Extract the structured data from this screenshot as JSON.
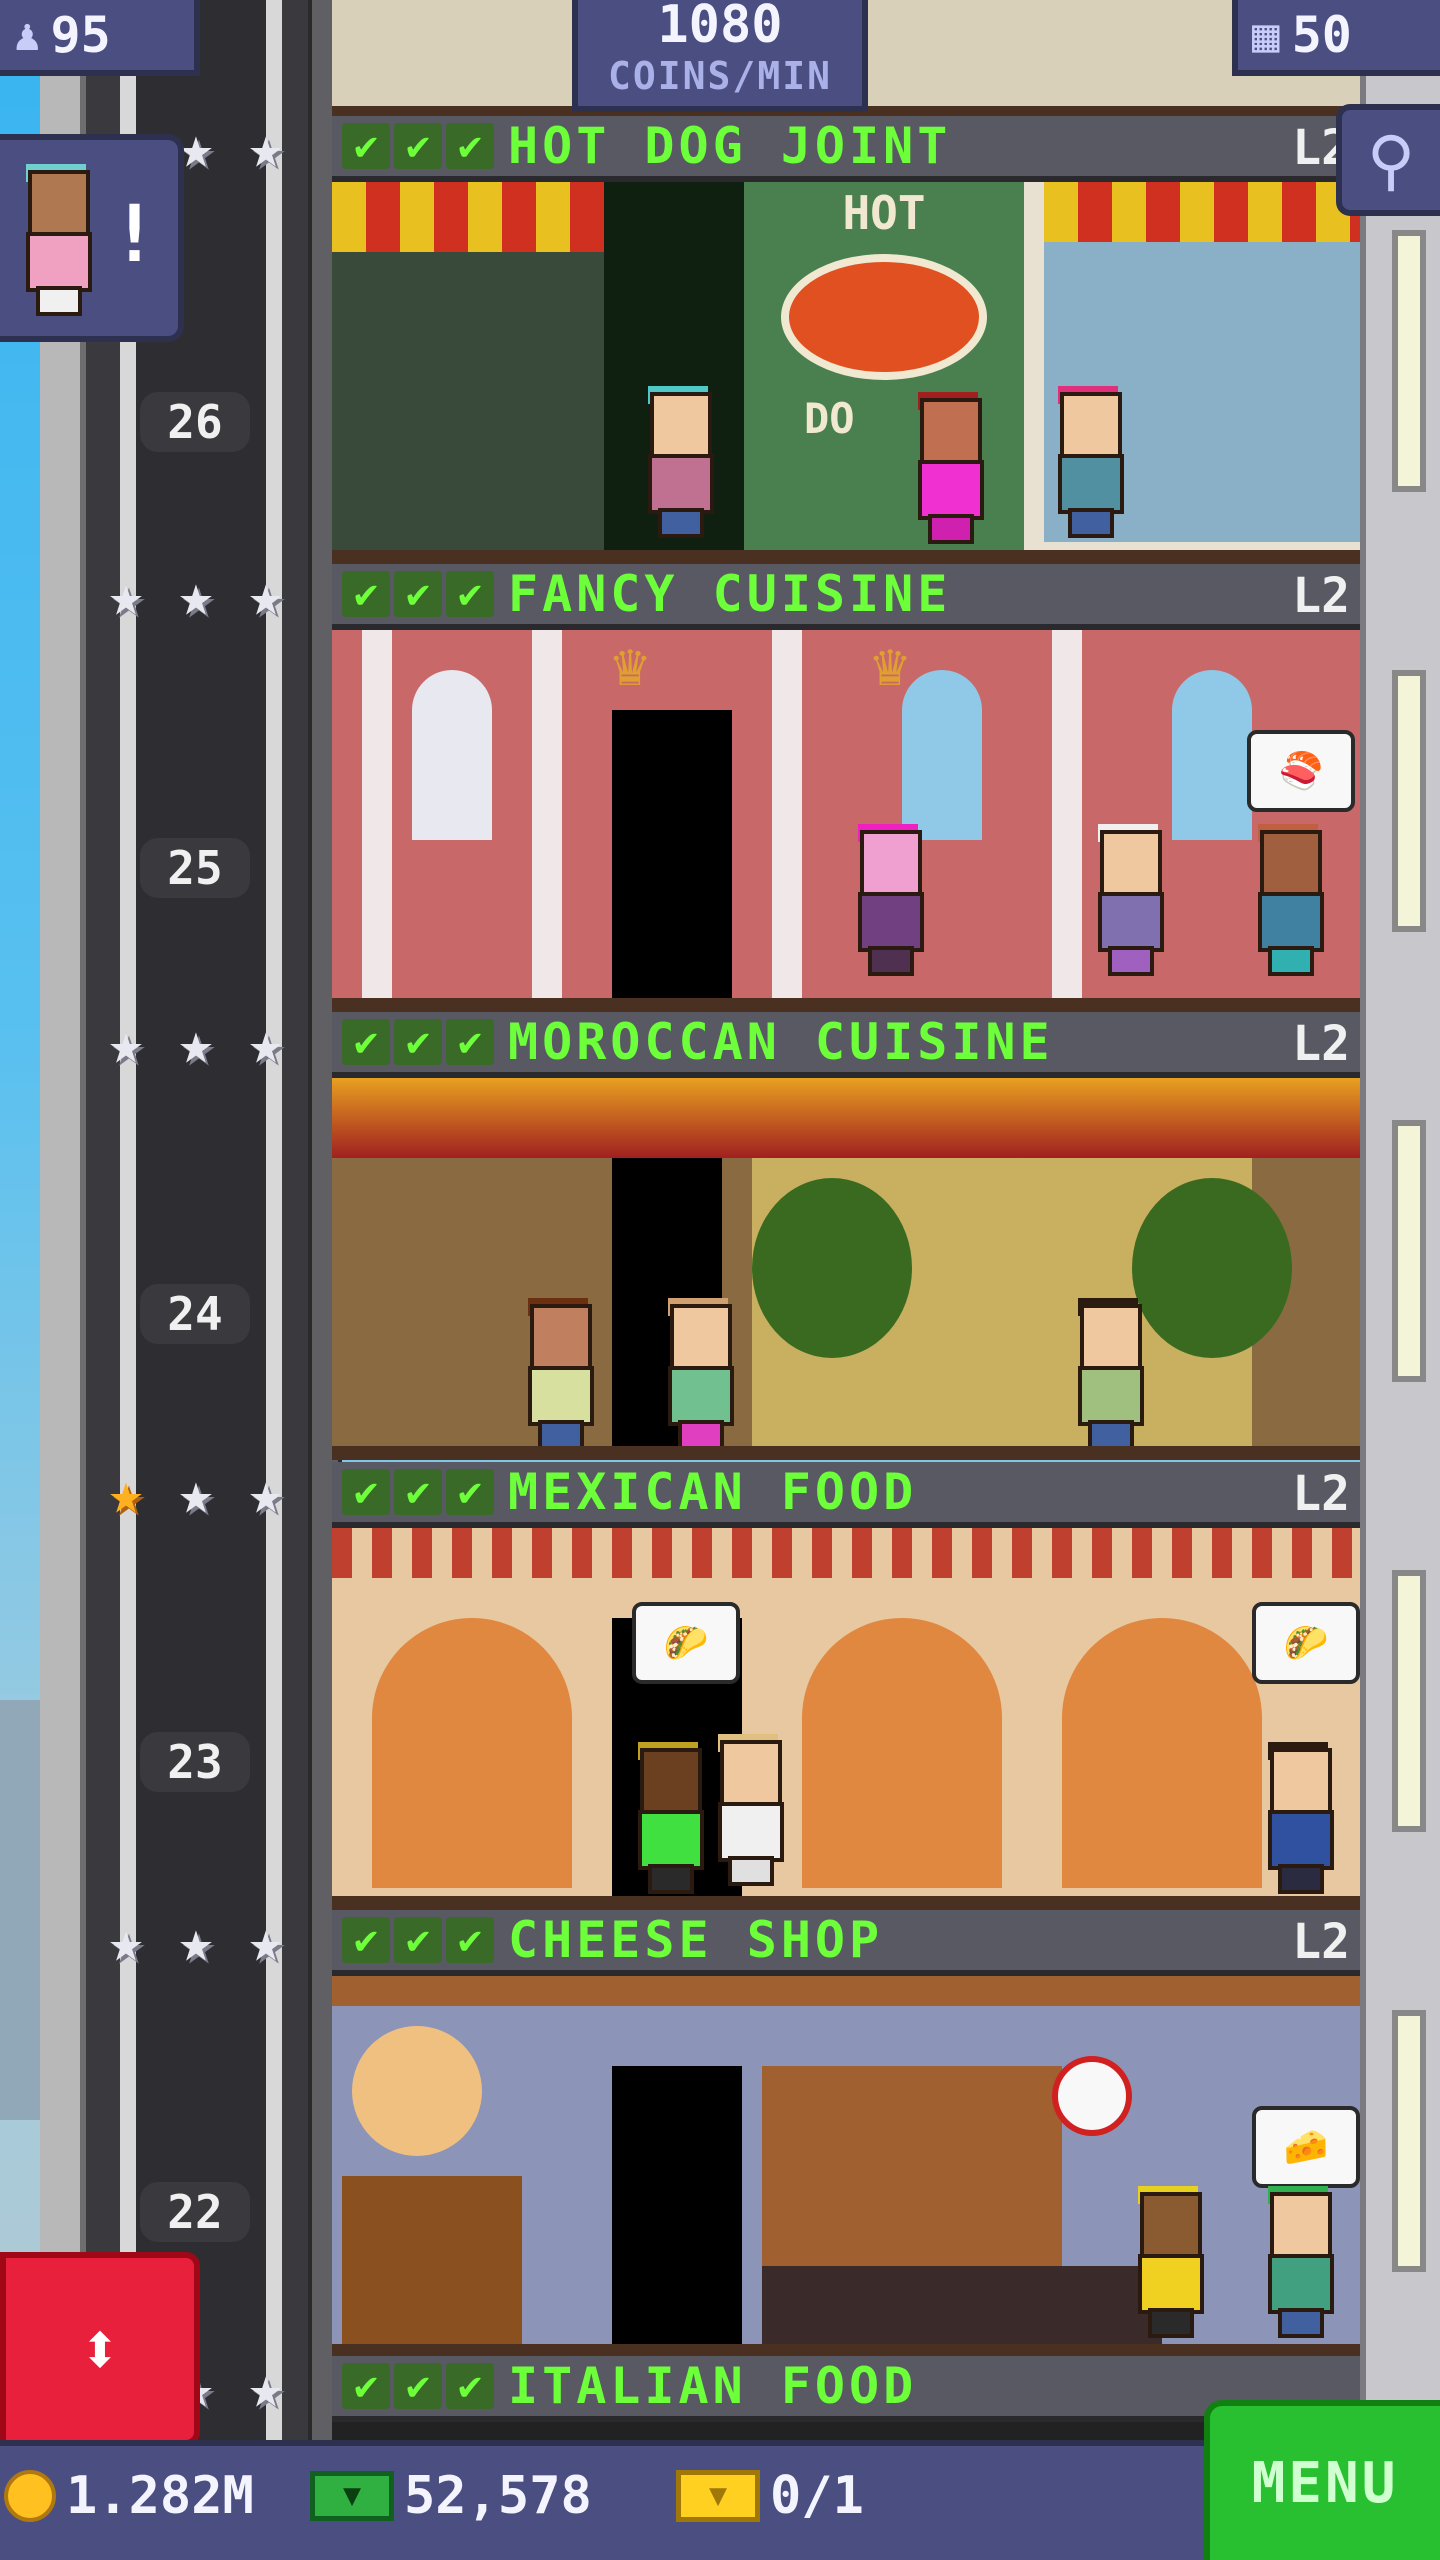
{
  "hud": {
    "population": "95",
    "coins_per_min_value": "1080",
    "coins_per_min_unit": "COINS/MIN",
    "floor_count": "50"
  },
  "floors": [
    {
      "name": "HOT DOG JOINT",
      "level": "L2",
      "number": "26",
      "stars_gold": 0,
      "sign": "HOT",
      "sign2": "DO"
    },
    {
      "name": "FANCY CUISINE",
      "level": "L2",
      "number": "25",
      "stars_gold": 0
    },
    {
      "name": "MOROCCAN CUISINE",
      "level": "L2",
      "number": "24",
      "stars_gold": 0
    },
    {
      "name": "MEXICAN FOOD",
      "level": "L2",
      "number": "23",
      "stars_gold": 1
    },
    {
      "name": "CHEESE SHOP",
      "level": "L2",
      "number": "22",
      "stars_gold": 0
    },
    {
      "name": "ITALIAN FOOD",
      "level": "",
      "number": "",
      "stars_gold": 0
    }
  ],
  "bottom": {
    "coins": "1.282M",
    "bux": "52,578",
    "tickets": "0/1",
    "menu_label": "MENU"
  },
  "icons": {
    "population": "person-icon",
    "floors": "building-icon",
    "zoom": "magnifier-icon",
    "elevator": "up-down-arrows-icon"
  },
  "colors": {
    "hud_bg": "#4a4e80",
    "floor_name": "#6cff3a",
    "menu_bg": "#28c030",
    "elevator_button": "#e8203c"
  }
}
